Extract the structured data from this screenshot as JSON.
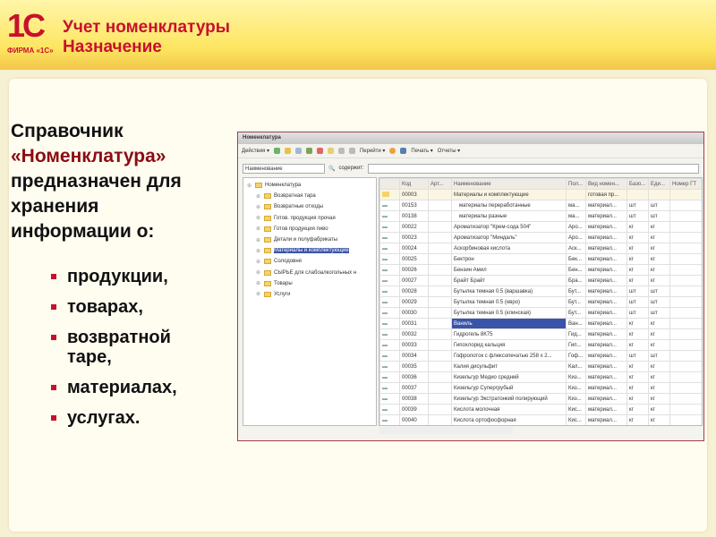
{
  "header": {
    "logo_text": "1С",
    "logo_caption": "ФИРМА «1С»",
    "title_line1": "Учет номенклатуры",
    "title_line2": "Назначение"
  },
  "intro": {
    "line1": "Справочник",
    "line2": "«Номенклатура»",
    "line3": "предназначен для",
    "line4": "хранения",
    "line5": "информации о:"
  },
  "bullets": [
    "продукции,",
    "товарах,",
    "возвратной таре,",
    "материалах,",
    "услугах."
  ],
  "window": {
    "title": "Номенклатура",
    "toolbar": {
      "actions": "Действия ▾",
      "goto": "Перейти ▾",
      "print": "Печать ▾",
      "reports": "Отчеты ▾"
    },
    "filter": {
      "field": "Наименование",
      "contains_label": "содержит:",
      "value": ""
    },
    "tree": {
      "root": "Номенклатура",
      "items": [
        "Возвратная тара",
        "Возвратные отходы",
        "Готов. продукция прочая",
        "Готов продукция пиво",
        "Детали и полуфабрикаты",
        "Материалы и комплектующие",
        "Солодовня",
        "СЫРЬЕ для слабоалкогольных н",
        "Товары",
        "Услуги"
      ],
      "selected_index": 5
    },
    "columns": [
      "",
      "Код",
      "Арт...",
      "Наименование",
      "Пол...",
      "Вид номен...",
      "Базо...",
      "Еди...",
      "Номер ГТ"
    ],
    "rows": [
      [
        "00003",
        "",
        "Материалы и комплектующие",
        "",
        "готовая пр...",
        "",
        ""
      ],
      [
        "00153",
        "",
        "материалы переработанные",
        "ма...",
        "материал...",
        "шт",
        "шт"
      ],
      [
        "00138",
        "",
        "материалы разные",
        "ма...",
        "материал...",
        "шт",
        "шт"
      ],
      [
        "00022",
        "",
        "Ароматизатор \"Крем-сода 504\"",
        "Аро...",
        "материал...",
        "кг",
        "кг"
      ],
      [
        "00023",
        "",
        "Ароматизатор \"Миндаль\"",
        "Аро...",
        "материал...",
        "кг",
        "кг"
      ],
      [
        "00024",
        "",
        "Аскорбиновая кислота",
        "Аск...",
        "материал...",
        "кг",
        "кг"
      ],
      [
        "00025",
        "",
        "Бектрон",
        "Бек...",
        "материал...",
        "кг",
        "кг"
      ],
      [
        "00026",
        "",
        "Бензин Амил",
        "Бен...",
        "материал...",
        "кг",
        "кг"
      ],
      [
        "00027",
        "",
        "Брайт Брайт",
        "Бра...",
        "материал...",
        "кг",
        "кг"
      ],
      [
        "00028",
        "",
        "Бутылка темная 0.5 (варшавка)",
        "Бут...",
        "материал...",
        "шт",
        "шт"
      ],
      [
        "00029",
        "",
        "Бутылка темная 0.5 (евро)",
        "Бут...",
        "материал...",
        "шт",
        "шт"
      ],
      [
        "00030",
        "",
        "Бутылка темная 0.5 (клинская)",
        "Бут...",
        "материал...",
        "шт",
        "шт"
      ],
      [
        "00031",
        "",
        "Ваниль",
        "Ван...",
        "материал...",
        "кг",
        "кг"
      ],
      [
        "00032",
        "",
        "Гидрогель 8К75",
        "Гид...",
        "материал...",
        "кг",
        "кг"
      ],
      [
        "00033",
        "",
        "Гипохлорид кальция",
        "Гип...",
        "материал...",
        "кг",
        "кг"
      ],
      [
        "00034",
        "",
        "Гофролоток с флексопечатью 258 x 2...",
        "Гоф...",
        "материал...",
        "шт",
        "шт"
      ],
      [
        "00035",
        "",
        "Калия дисульфит",
        "Кал...",
        "материал...",
        "кг",
        "кг"
      ],
      [
        "00036",
        "",
        "Кизельгур Медио средний",
        "Киз...",
        "материал...",
        "кг",
        "кг"
      ],
      [
        "00037",
        "",
        "Кизельгур Супергрубый",
        "Киз...",
        "материал...",
        "кг",
        "кг"
      ],
      [
        "00038",
        "",
        "Кизельгур Экстратонкий полирующий",
        "Киз...",
        "материал...",
        "кг",
        "кг"
      ],
      [
        "00039",
        "",
        "Кислота молочная",
        "Кис...",
        "материал...",
        "кг",
        "кг"
      ],
      [
        "00040",
        "",
        "Кислота ортофосфорная",
        "Кис...",
        "материал...",
        "кг",
        "кг"
      ]
    ],
    "selected_row": 12
  }
}
